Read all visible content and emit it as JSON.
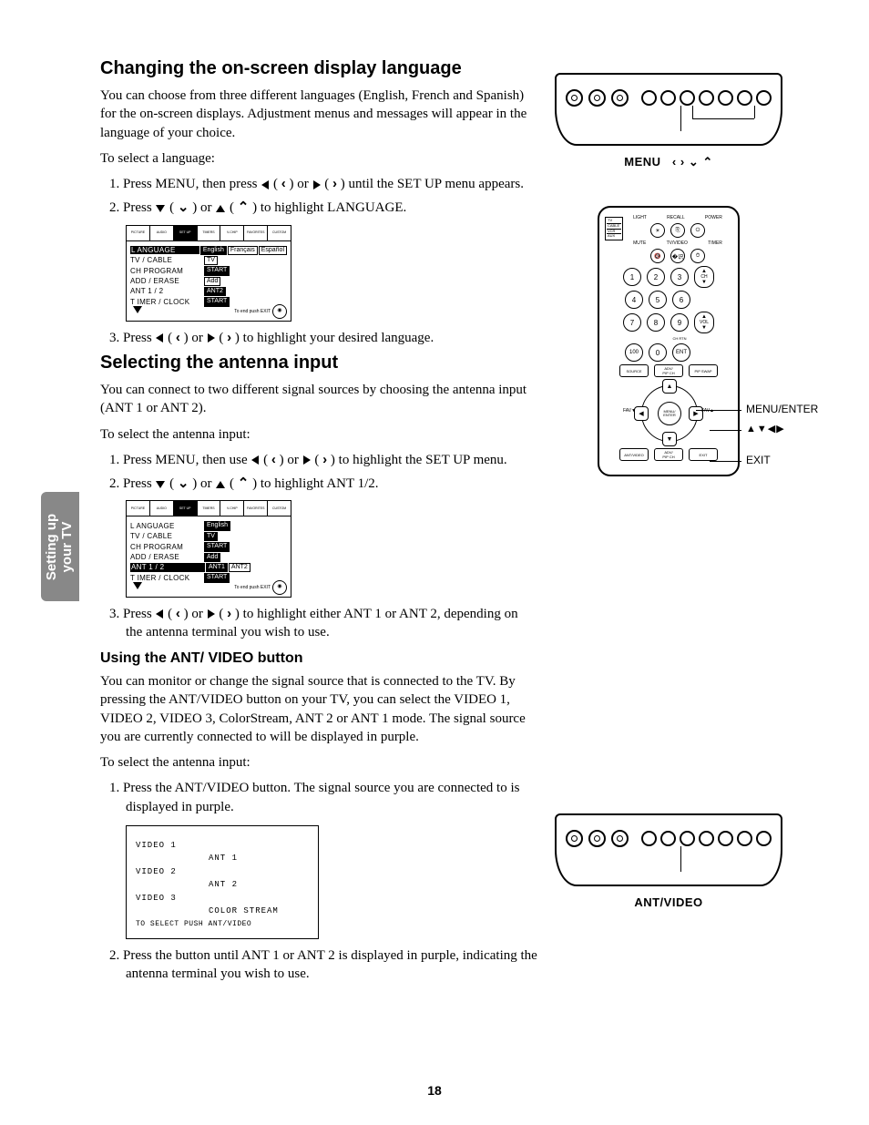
{
  "sideTab": {
    "line1": "Setting up",
    "line2": "your TV"
  },
  "sec1": {
    "title": "Changing the on-screen display language",
    "intro": "You can choose from three different languages (English, French and Spanish) for the on-screen displays. Adjustment menus and messages will appear in the language of your choice.",
    "lead": "To select a language:",
    "step1a": "1.  Press MENU, then press ",
    "step1b": " ( ",
    "step1c": " ) or ",
    "step1d": " ( ",
    "step1e": " ) until the SET UP menu appears.",
    "step2a": "2.  Press ",
    "step2b": " ( ",
    "step2c": " ) or ",
    "step2d": " ( ",
    "step2e": " ) to highlight LANGUAGE.",
    "step3a": "3.  Press ",
    "step3b": " ( ",
    "step3c": " ) or ",
    "step3d": " ( ",
    "step3e": " ) to highlight your desired language."
  },
  "sec2": {
    "title": "Selecting the antenna input",
    "intro": "You can connect to two different signal sources by choosing the antenna input (ANT 1 or ANT 2).",
    "lead": "To select the antenna input:",
    "step1a": "1.  Press MENU, then use ",
    "step1b": " ( ",
    "step1c": " ) or ",
    "step1d": " ( ",
    "step1e": " ) to highlight the SET UP menu.",
    "step2a": "2.  Press ",
    "step2b": " ( ",
    "step2c": " ) or ",
    "step2d": " ( ",
    "step2e": " ) to highlight ANT 1/2.",
    "step3a": "3.  Press ",
    "step3b": " ( ",
    "step3c": " ) or ",
    "step3d": " ( ",
    "step3e": " ) to highlight either ANT 1 or ANT 2, depending on the antenna terminal you wish to use."
  },
  "sec3": {
    "title": "Using the ANT/ VIDEO button",
    "intro": "You can monitor or change the signal source that is connected to the TV. By pressing the ANT/VIDEO button on your TV, you can select the VIDEO 1, VIDEO 2, VIDEO 3, ColorStream, ANT 2 or ANT 1 mode. The signal source you are currently connected to will be displayed in purple.",
    "lead": "To select the antenna input:",
    "step1": "1.  Press the ANT/VIDEO button. The signal source you are connected to is displayed in purple.",
    "step2": "2.  Press the button until ANT 1 or ANT 2 is displayed in purple, indicating the antenna terminal you wish to use."
  },
  "osdTabs": [
    "PICTURE",
    "AUDIO",
    "SET UP",
    "TIMERS",
    "V-CHIP",
    "FAVORITES",
    "CUSTOM"
  ],
  "osd1": {
    "rows": [
      {
        "label": "L ANGUAGE",
        "sel": true,
        "vals": [
          {
            "t": "English",
            "sel": true
          },
          {
            "t": "Français"
          },
          {
            "t": "Español"
          }
        ]
      },
      {
        "label": "TV / CABLE",
        "vals": [
          {
            "t": "TV"
          }
        ]
      },
      {
        "label": "CH   PROGRAM",
        "vals": [
          {
            "t": "START",
            "sel": true
          }
        ]
      },
      {
        "label": "ADD / ERASE",
        "vals": [
          {
            "t": "Add"
          }
        ]
      },
      {
        "label": "ANT 1 / 2",
        "vals": [
          {
            "t": "ANT2",
            "sel": true
          }
        ]
      },
      {
        "label": "T IMER / CLOCK",
        "vals": [
          {
            "t": "START",
            "sel": true
          }
        ]
      }
    ],
    "footer": "To end push EXIT"
  },
  "osd2": {
    "rows": [
      {
        "label": "L ANGUAGE",
        "vals": [
          {
            "t": "English",
            "sel": true
          }
        ]
      },
      {
        "label": "TV / CABLE",
        "vals": [
          {
            "t": "TV",
            "sel": true
          }
        ]
      },
      {
        "label": "CH   PROGRAM",
        "vals": [
          {
            "t": "START",
            "sel": true
          }
        ]
      },
      {
        "label": "ADD / ERASE",
        "vals": [
          {
            "t": "Add",
            "sel": true
          }
        ]
      },
      {
        "label": "ANT 1 / 2",
        "sel": true,
        "vals": [
          {
            "t": "ANT1",
            "sel": true
          },
          {
            "t": "ANT2"
          }
        ]
      },
      {
        "label": "T IMER / CLOCK",
        "vals": [
          {
            "t": "START",
            "sel": true
          }
        ]
      }
    ],
    "footer": "To end push EXIT"
  },
  "vidOsd": {
    "left": [
      "VIDEO 1",
      "VIDEO 2",
      "VIDEO 3"
    ],
    "right": [
      "ANT 1",
      "ANT 2",
      "COLOR STREAM"
    ],
    "footer": "TO SELECT PUSH ANT/VIDEO"
  },
  "tvPanel1": {
    "label": "MENU"
  },
  "tvPanel2": {
    "label": "ANT/VIDEO"
  },
  "remote": {
    "topLabels": [
      "LIGHT",
      "RECALL",
      "POWER"
    ],
    "row2Labels": [
      "MUTE",
      "TV/VIDEO",
      "TIMER"
    ],
    "switch": [
      "TV",
      "CABLE",
      "VCR",
      "AUX"
    ],
    "nums": [
      "1",
      "2",
      "3",
      "4",
      "5",
      "6",
      "7",
      "8",
      "9",
      "100",
      "0",
      "ENT"
    ],
    "ch": "CH",
    "vol": "VOL",
    "chrtn": "CH RTN",
    "adv": "ADV/\nPIP CH",
    "favUp": "FAV▲",
    "favDn": "FAV▼",
    "center": "MENU/\nENTER",
    "exit": "EXIT",
    "source": "SOURCE",
    "pipSwap": "PIP SWAP",
    "ant": "ANT/VIDEO",
    "callout1": "MENU/ENTER",
    "callout2": "▲▼◀▶",
    "callout3": "EXIT"
  },
  "pageNum": "18"
}
